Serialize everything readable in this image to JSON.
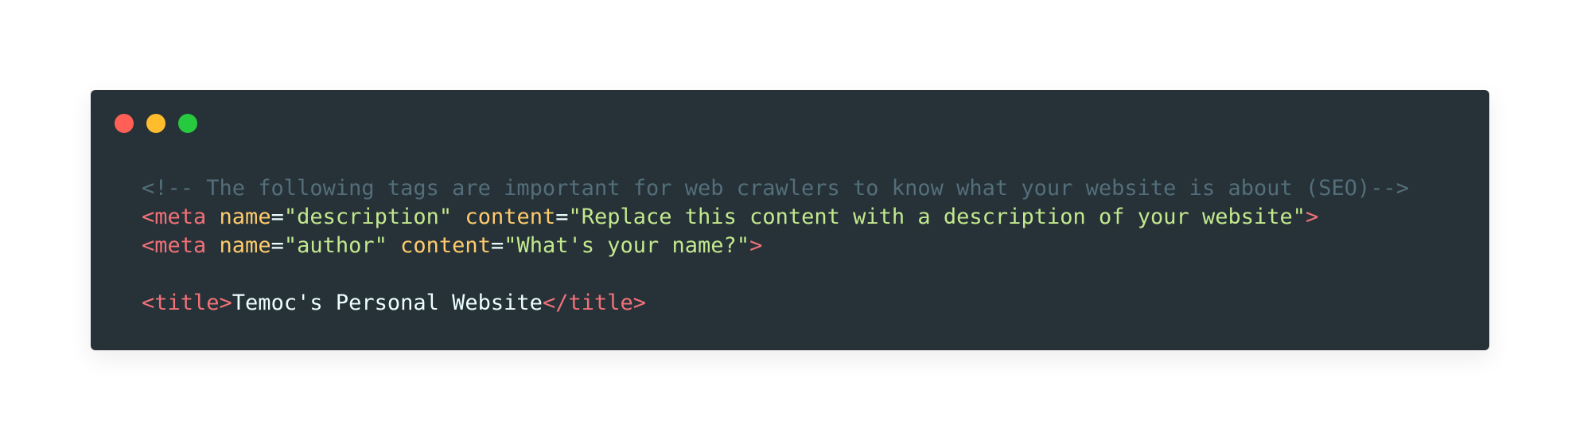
{
  "window": {
    "controls": [
      {
        "name": "close",
        "color": "#ff5f56",
        "icon": "close-dot-icon"
      },
      {
        "name": "minimize",
        "color": "#ffbd2e",
        "icon": "minimize-dot-icon"
      },
      {
        "name": "maximize",
        "color": "#27c93f",
        "icon": "maximize-dot-icon"
      }
    ]
  },
  "code": {
    "line1": {
      "comment": "<!-- The following tags are important for web crawlers to know what your website is about (SEO)-->"
    },
    "line2": {
      "open": "<meta",
      "attr1": "name",
      "eq1": "=",
      "val1": "\"description\"",
      "attr2": "content",
      "eq2": "=",
      "val2": "\"Replace this content with a description of your website\"",
      "close": ">"
    },
    "line3": {
      "open": "<meta",
      "attr1": "name",
      "eq1": "=",
      "val1": "\"author\"",
      "attr2": "content",
      "eq2": "=",
      "val2": "\"What's your name?\"",
      "close": ">"
    },
    "line5": {
      "open_tag": "<title>",
      "text": "Temoc's Personal Website",
      "close_tag": "</title>"
    }
  },
  "colors": {
    "background": "#263238",
    "comment": "#546e7a",
    "tag": "#f07178",
    "attribute": "#ffcb6b",
    "string": "#c3e88d",
    "text": "#eeffff"
  }
}
